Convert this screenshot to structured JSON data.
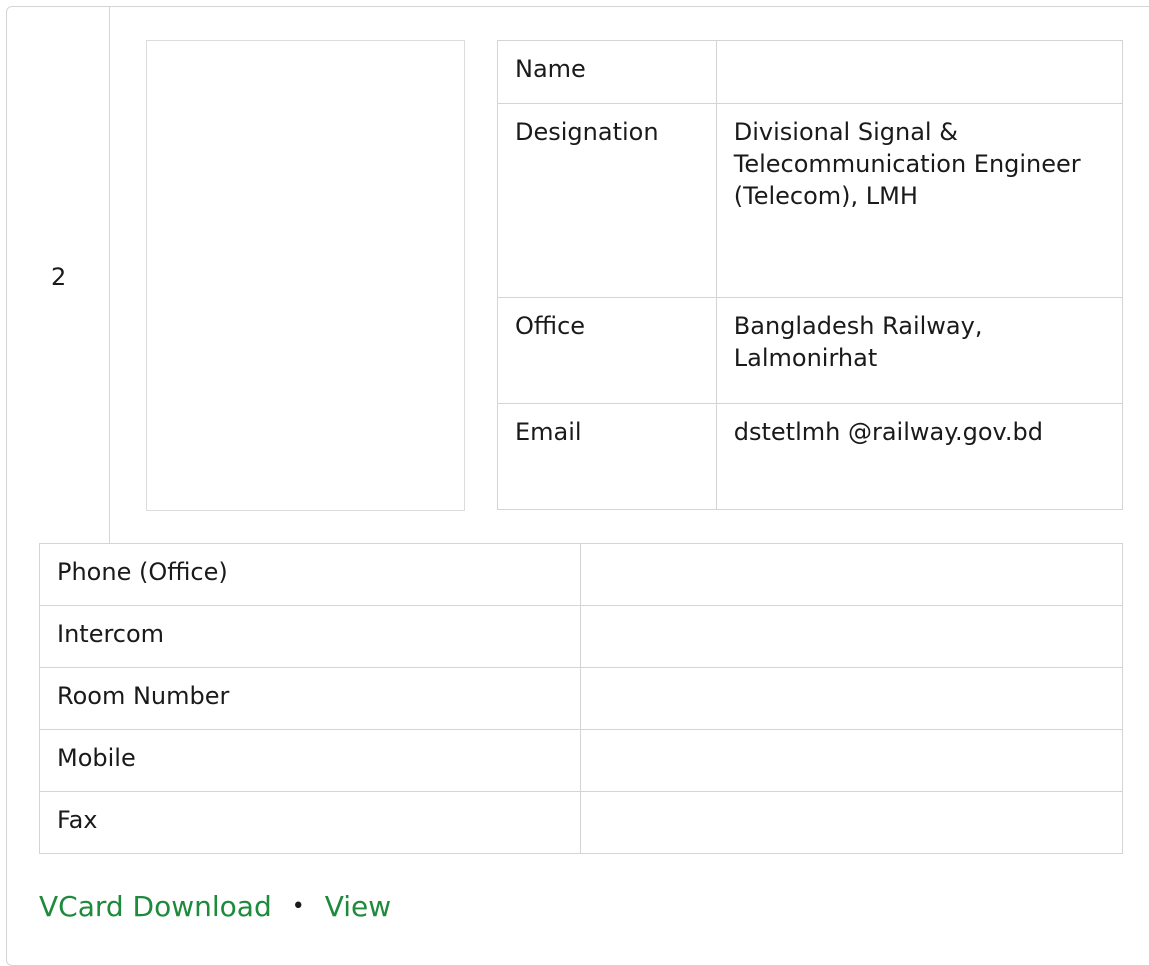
{
  "entry": {
    "index": "2",
    "details": [
      {
        "label": "Name",
        "value": ""
      },
      {
        "label": "Designation",
        "value": "Divisional Signal & Telecommunication Engineer (Telecom), LMH"
      },
      {
        "label": "Office",
        "value": "Bangladesh Railway, Lalmonirhat"
      },
      {
        "label": "Email",
        "value": "dstetlmh @railway.gov.bd"
      }
    ],
    "contacts": [
      {
        "label": "Phone (Office)",
        "value": ""
      },
      {
        "label": "Intercom",
        "value": ""
      },
      {
        "label": "Room Number",
        "value": ""
      },
      {
        "label": "Mobile",
        "value": ""
      },
      {
        "label": "Fax",
        "value": ""
      }
    ]
  },
  "links": {
    "vcard": "VCard Download",
    "separator": "•",
    "view": "View"
  },
  "colors": {
    "link": "#1e8a3c",
    "border": "#d4d4d4"
  }
}
